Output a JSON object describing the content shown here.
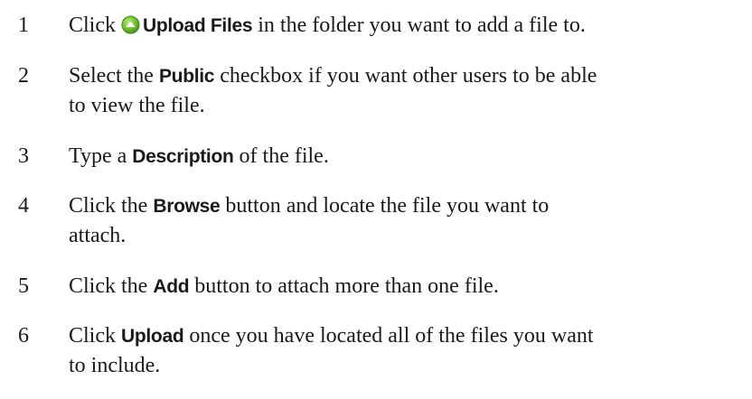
{
  "steps": [
    {
      "num": "1",
      "pre": "Click ",
      "icon": "upload-arrow-icon",
      "ui": "Upload Files",
      "post": " in the folder you want to add a file to."
    },
    {
      "num": "2",
      "pre": "Select the ",
      "ui": "Public",
      "post": " checkbox if you want other users to be able",
      "post2": "to view the file."
    },
    {
      "num": "3",
      "pre": "Type a ",
      "ui": "Description",
      "post": " of the file."
    },
    {
      "num": "4",
      "pre": "Click the ",
      "ui": "Browse",
      "post": " button and locate the file you want to",
      "post2": "attach."
    },
    {
      "num": "5",
      "pre": "Click the ",
      "ui": "Add",
      "post": " button to attach more than one file."
    },
    {
      "num": "6",
      "pre": "Click ",
      "ui": "Upload",
      "post": " once you have located all of the files you want",
      "post2": "to include."
    }
  ],
  "colors": {
    "icon_fill": "#6dbb2e",
    "icon_fill_dark": "#3f8a16",
    "text": "#1a1a1a"
  }
}
